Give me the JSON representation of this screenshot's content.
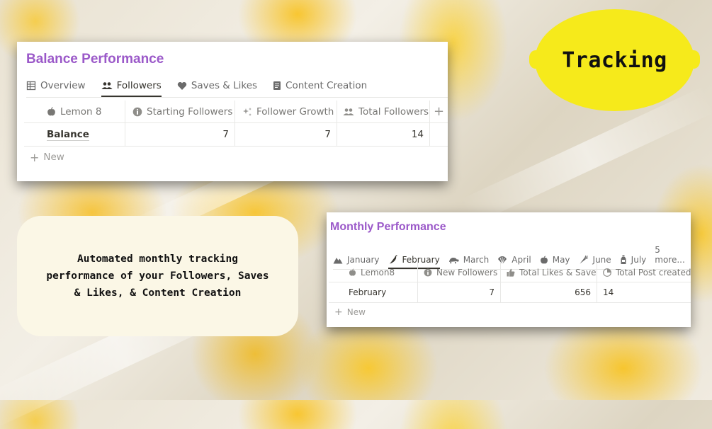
{
  "background": {
    "fabric_color": "#efe9dc",
    "lemon_color": "#f7c526"
  },
  "balance": {
    "title": "Balance Performance",
    "tabs": [
      {
        "label": "Overview",
        "icon": "table-icon",
        "active": false
      },
      {
        "label": "Followers",
        "icon": "people-icon",
        "active": true
      },
      {
        "label": "Saves & Likes",
        "icon": "heart-icon",
        "active": false
      },
      {
        "label": "Content Creation",
        "icon": "document-icon",
        "active": false
      }
    ],
    "columns": [
      {
        "label": "Lemon 8",
        "icon": "apple-icon"
      },
      {
        "label": "Starting Followers",
        "icon": "info-icon"
      },
      {
        "label": "Follower Growth",
        "icon": "sparkle-icon"
      },
      {
        "label": "Total Followers",
        "icon": "people-icon"
      }
    ],
    "add_column_label": "+",
    "rows": [
      {
        "name": "Balance",
        "starting": "7",
        "growth": "7",
        "total": "14"
      }
    ],
    "new_label": "New"
  },
  "monthly": {
    "title": "Monthly Performance",
    "tabs": [
      {
        "label": "January",
        "icon": "mountain-icon",
        "active": false
      },
      {
        "label": "February",
        "icon": "chili-icon",
        "active": true
      },
      {
        "label": "March",
        "icon": "turtle-icon",
        "active": false
      },
      {
        "label": "April",
        "icon": "shell-icon",
        "active": false
      },
      {
        "label": "May",
        "icon": "apple-icon",
        "active": false
      },
      {
        "label": "June",
        "icon": "carrot-icon",
        "active": false
      },
      {
        "label": "July",
        "icon": "bottle-icon",
        "active": false
      }
    ],
    "more_label": "5 more...",
    "columns": [
      {
        "label": "Lemon8",
        "icon": "apple-icon"
      },
      {
        "label": "New Followers",
        "icon": "info-icon"
      },
      {
        "label": "Total Likes & Save",
        "icon": "thumbs-up-icon"
      },
      {
        "label": "Total Post created",
        "icon": "pie-icon"
      }
    ],
    "rows": [
      {
        "name": "February",
        "new_followers": "7",
        "likes_saves": "656",
        "posts": "14"
      }
    ],
    "new_label": "New"
  },
  "callouts": {
    "tracking": "Tracking",
    "description": "Automated monthly tracking performance of your Followers, Saves & Likes, & Content Creation"
  }
}
